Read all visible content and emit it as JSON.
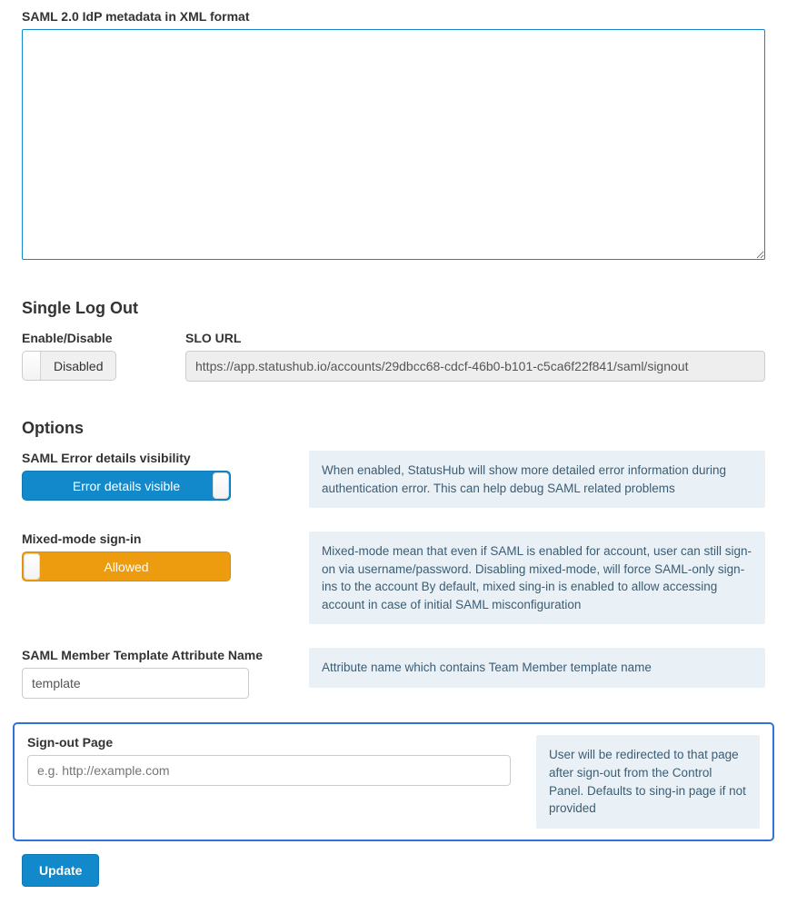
{
  "metadata": {
    "label": "SAML 2.0 IdP metadata in XML format",
    "value": ""
  },
  "slo": {
    "heading": "Single Log Out",
    "enable_label": "Enable/Disable",
    "toggle_label": "Disabled",
    "url_label": "SLO URL",
    "url_value": "https://app.statushub.io/accounts/29dbcc68-cdcf-46b0-b101-c5ca6f22f841/saml/signout"
  },
  "options": {
    "heading": "Options",
    "error_details": {
      "label": "SAML Error details visibility",
      "toggle_label": "Error details visible",
      "help": "When enabled, StatusHub will show more detailed error information during authentication error. This can help debug SAML related problems"
    },
    "mixed_mode": {
      "label": "Mixed-mode sign-in",
      "toggle_label": "Allowed",
      "help": "Mixed-mode mean that even if SAML is enabled for account, user can still sign-on via username/password. Disabling mixed-mode, will force SAML-only sign-ins to the account By default, mixed sing-in is enabled to allow accessing account in case of initial SAML misconfiguration"
    },
    "template_attr": {
      "label": "SAML Member Template Attribute Name",
      "value": "template",
      "help": "Attribute name which contains Team Member template name"
    },
    "signout": {
      "label": "Sign-out Page",
      "placeholder": "e.g. http://example.com",
      "value": "",
      "help": "User will be redirected to that page after sign-out from the Control Panel. Defaults to sing-in page if not provided"
    }
  },
  "update_label": "Update"
}
